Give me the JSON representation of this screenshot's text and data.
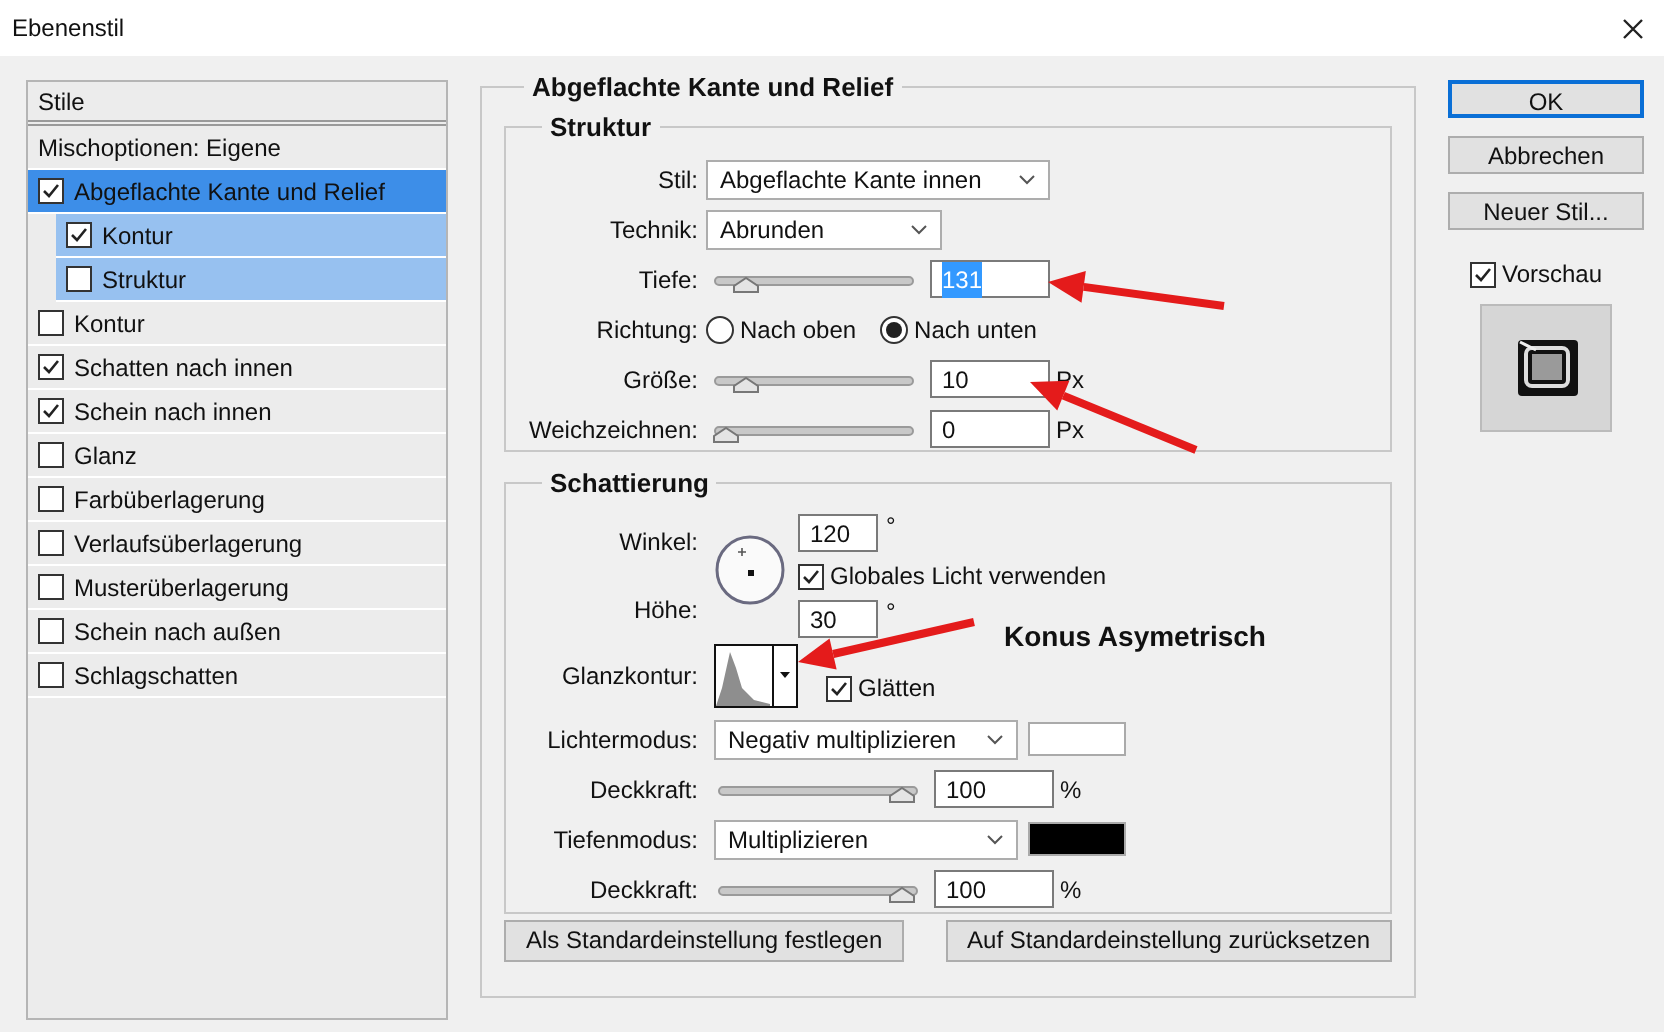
{
  "window": {
    "title": "Ebenenstil"
  },
  "styles_list": {
    "header": "Stile",
    "items": [
      {
        "label": "Mischoptionen: Eigene",
        "kind": "plain",
        "selected": false
      },
      {
        "label": "Abgeflachte Kante und Relief",
        "kind": "check",
        "checked": true,
        "selected": true,
        "children": [
          {
            "label": "Kontur",
            "checked": true
          },
          {
            "label": "Struktur",
            "checked": false
          }
        ]
      },
      {
        "label": "Kontur",
        "kind": "check",
        "checked": false,
        "selected": false
      },
      {
        "label": "Schatten nach innen",
        "kind": "check",
        "checked": true,
        "selected": false
      },
      {
        "label": "Schein nach innen",
        "kind": "check",
        "checked": true,
        "selected": false
      },
      {
        "label": "Glanz",
        "kind": "check",
        "checked": false,
        "selected": false
      },
      {
        "label": "Farbüberlagerung",
        "kind": "check",
        "checked": false,
        "selected": false
      },
      {
        "label": "Verlaufsüberlagerung",
        "kind": "check",
        "checked": false,
        "selected": false
      },
      {
        "label": "Musterüberlagerung",
        "kind": "check",
        "checked": false,
        "selected": false
      },
      {
        "label": "Schein nach außen",
        "kind": "check",
        "checked": false,
        "selected": false
      },
      {
        "label": "Schlagschatten",
        "kind": "check",
        "checked": false,
        "selected": false
      }
    ]
  },
  "panel": {
    "title": "Abgeflachte Kante und Relief",
    "structure": {
      "title": "Struktur",
      "rows": [
        {
          "kind": "select",
          "label": "Stil:",
          "value": "Abgeflachte Kante innen"
        },
        {
          "kind": "select",
          "label": "Technik:",
          "value": "Abrunden"
        },
        {
          "kind": "slider",
          "label": "Tiefe:",
          "level": 0.12,
          "value": "131",
          "highlighted": true
        },
        {
          "kind": "radio",
          "label": "Richtung:",
          "options": [
            {
              "label": "Nach oben",
              "selected": false
            },
            {
              "label": "Nach unten",
              "selected": true
            }
          ]
        },
        {
          "kind": "slider",
          "label": "Größe:",
          "level": 0.12,
          "value": "10",
          "unit": "Px",
          "highlighted": false
        },
        {
          "kind": "slider",
          "label": "Weichzeichnen:",
          "level": 0,
          "value": "0",
          "unit": "Px",
          "highlighted": false
        }
      ]
    },
    "shading": {
      "title": "Schattierung",
      "angle": {
        "label": "Winkel:",
        "value": "120",
        "unit": "°"
      },
      "global_light": {
        "label": "Globales Licht verwenden",
        "checked": true
      },
      "altitude": {
        "label": "Höhe:",
        "value": "30",
        "unit": "°"
      },
      "gloss_contour": {
        "label": "Glanzkontur:"
      },
      "smooth": {
        "label": "Glätten",
        "checked": true
      },
      "rows": [
        {
          "kind": "select",
          "label": "Lichtermodus:",
          "value": "Negativ multiplizieren",
          "color": "#ffffff"
        },
        {
          "kind": "slider",
          "label": "Deckkraft:",
          "level": 1,
          "value": "100",
          "unit": "%"
        },
        {
          "kind": "select",
          "label": "Tiefenmodus:",
          "value": "Multiplizieren",
          "color": "#000000"
        },
        {
          "kind": "slider",
          "label": "Deckkraft:",
          "level": 1,
          "value": "100",
          "unit": "%"
        }
      ]
    },
    "buttons": [
      "Als Standardeinstellung festlegen",
      "Auf Standardeinstellung zurücksetzen"
    ]
  },
  "side_buttons": [
    {
      "label": "OK",
      "default": true
    },
    {
      "label": "Abbrechen",
      "default": false
    },
    {
      "label": "Neuer Stil...",
      "default": false
    }
  ],
  "preview": {
    "label": "Vorschau",
    "checked": true
  },
  "annotation": {
    "text": "Konus Asymetrisch"
  }
}
